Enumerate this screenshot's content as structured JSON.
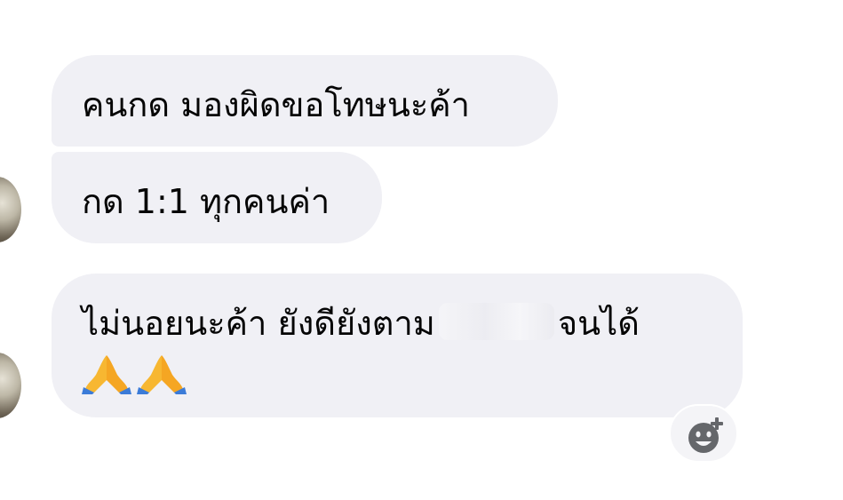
{
  "messages": [
    {
      "text": "คนกด มองผิดขอโทษนะค้า"
    },
    {
      "text": "กด 1:1 ทุกคนค่า"
    },
    {
      "text_before": "ไม่นอยนะค้า ยังดียังตาม",
      "text_after": "จนได้",
      "emoji": "🙏🙏"
    }
  ],
  "icons": {
    "avatar": "sender-avatar",
    "pray": "folded-hands-emoji",
    "react": "add-reaction-icon"
  },
  "colors": {
    "bubble": "#f0f0f5",
    "text": "#050505",
    "react_icon": "#65676b"
  }
}
